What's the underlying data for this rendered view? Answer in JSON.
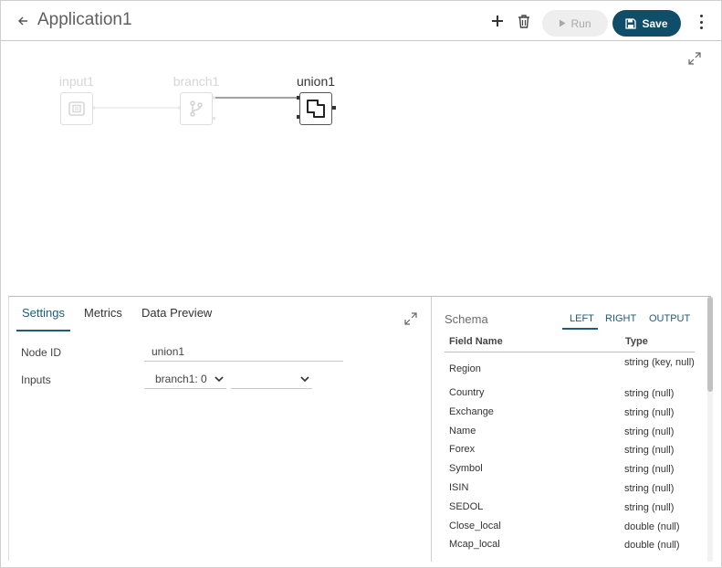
{
  "header": {
    "title": "Application1",
    "run_label": "Run",
    "save_label": "Save"
  },
  "colors": {
    "accent": "#0f4d68",
    "tab_active": "#1f5c78",
    "node_dim": "#d6d6d6"
  },
  "canvas": {
    "nodes": [
      {
        "label": "input1",
        "icon": "input-icon",
        "state": "dim"
      },
      {
        "label": "branch1",
        "icon": "branch-icon",
        "state": "dim"
      },
      {
        "label": "union1",
        "icon": "union-icon",
        "state": "active"
      }
    ]
  },
  "settings": {
    "tabs": [
      "Settings",
      "Metrics",
      "Data Preview"
    ],
    "active_tab": "Settings",
    "node_id_label": "Node ID",
    "node_id_value": "union1",
    "inputs_label": "Inputs",
    "inputs": [
      "branch1: 0",
      ""
    ]
  },
  "schema": {
    "title": "Schema",
    "tabs": [
      "LEFT",
      "RIGHT",
      "OUTPUT"
    ],
    "active_tab": "LEFT",
    "columns": [
      "Field Name",
      "Type"
    ],
    "rows": [
      {
        "name": "Region",
        "type": "string (key, null)"
      },
      {
        "name": "Country",
        "type": "string (null)"
      },
      {
        "name": "Exchange",
        "type": "string (null)"
      },
      {
        "name": "Name",
        "type": "string (null)"
      },
      {
        "name": "Forex",
        "type": "string (null)"
      },
      {
        "name": "Symbol",
        "type": "string (null)"
      },
      {
        "name": "ISIN",
        "type": "string (null)"
      },
      {
        "name": "SEDOL",
        "type": "string (null)"
      },
      {
        "name": "Close_local",
        "type": "double (null)"
      },
      {
        "name": "Mcap_local",
        "type": "double (null)"
      }
    ]
  }
}
